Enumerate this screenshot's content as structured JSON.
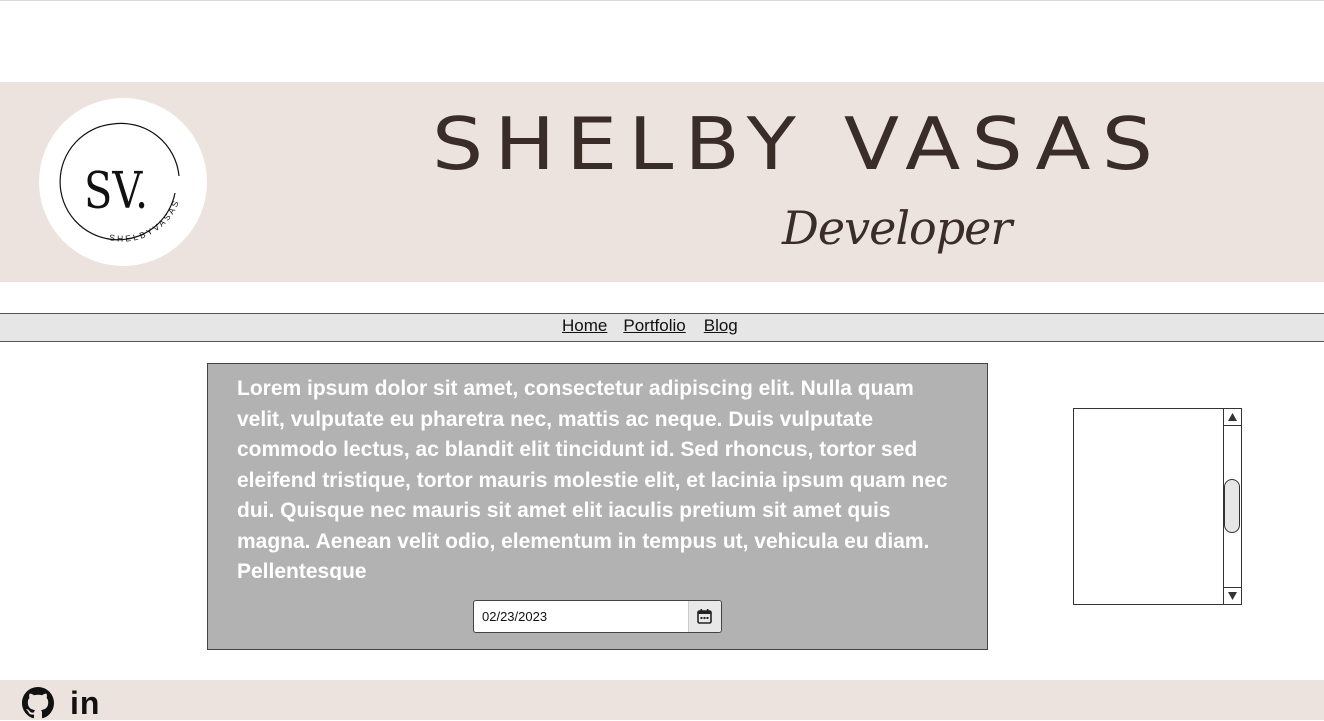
{
  "header": {
    "logo": {
      "initials": "SV.",
      "ring_text": "SHELBYVASAS"
    },
    "name": "SHELBY VASAS",
    "role": "Developer"
  },
  "nav": {
    "items": [
      {
        "label": "Home"
      },
      {
        "label": "Portfolio"
      },
      {
        "label": "Blog"
      }
    ]
  },
  "main": {
    "body_text": "Lorem ipsum dolor sit amet, consectetur adipiscing elit. Nulla quam velit, vulputate eu pharetra nec, mattis ac neque. Duis vulputate commodo lectus, ac blandit elit tincidunt id. Sed rhoncus, tortor sed eleifend tristique, tortor mauris molestie elit, et lacinia ipsum quam nec dui. Quisque nec mauris sit amet elit iaculis pretium sit amet quis magna. Aenean velit odio, elementum in tempus ut, vehicula eu diam. Pellentesque",
    "date_input": {
      "value": "02/23/2023",
      "icon": "calendar-icon"
    }
  },
  "side_panel": {
    "scroll_up_icon": "triangle-up-icon",
    "scroll_down_icon": "triangle-down-icon"
  },
  "footer": {
    "icons": [
      "github-icon",
      "linkedin-icon"
    ],
    "linkedin_text": "in"
  },
  "colors": {
    "header_bg": "#ece3de",
    "title_text": "#3a2d28",
    "content_bg": "#b2b2b2",
    "nav_bg": "#e6e6e6"
  }
}
